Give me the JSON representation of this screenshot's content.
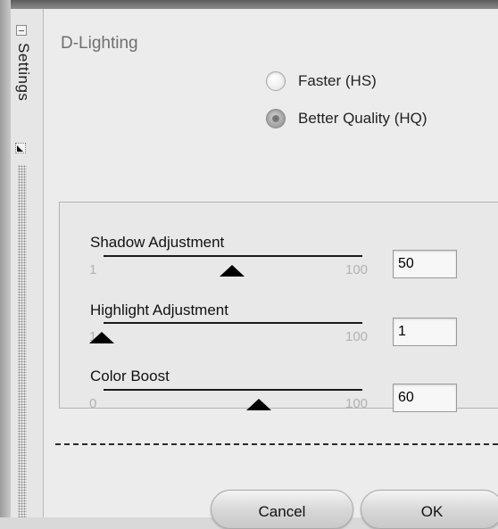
{
  "sidebar": {
    "label": "Settings"
  },
  "section": {
    "title": "D-Lighting"
  },
  "quality_options": [
    {
      "label": "Faster (HS)",
      "selected": false
    },
    {
      "label": "Better Quality (HQ)",
      "selected": true
    }
  ],
  "sliders": [
    {
      "label": "Shadow Adjustment",
      "min_label": "1",
      "max_label": "100",
      "value": "50",
      "level": 50
    },
    {
      "label": "Highlight Adjustment",
      "min_label": "1",
      "max_label": "100",
      "value": "1",
      "level": 1
    },
    {
      "label": "Color Boost",
      "min_label": "0",
      "max_label": "100",
      "value": "60",
      "level": 60
    }
  ],
  "buttons": {
    "cancel": "Cancel",
    "ok": "OK"
  }
}
